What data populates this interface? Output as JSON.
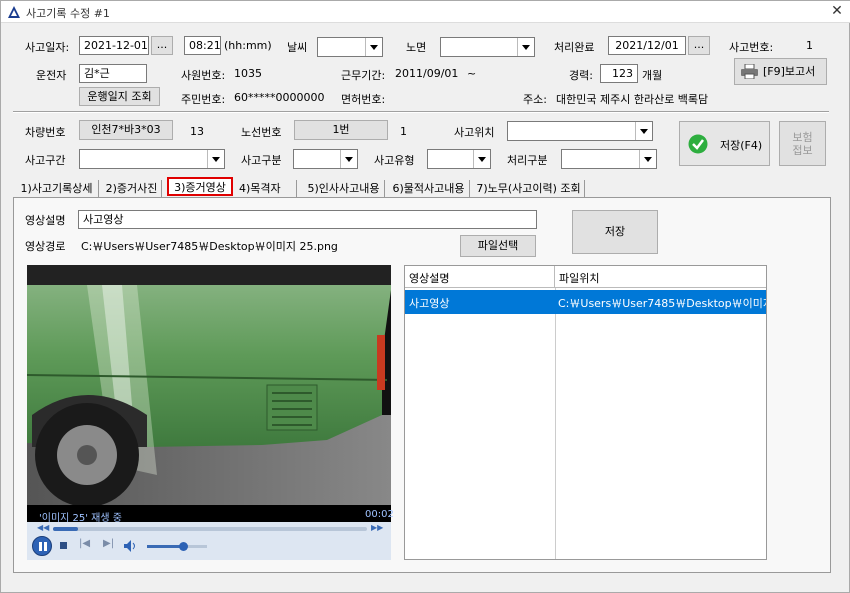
{
  "window": {
    "title": "사고기록 수정 #1",
    "close": "✕"
  },
  "row1": {
    "accident_date_label": "사고일자:",
    "accident_date": "2021-12-01",
    "date_picker": "...",
    "time": "08:21",
    "time_fmt": "(hh:mm)",
    "weather_label": "날씨",
    "road_label": "노면",
    "done_label": "처리완료",
    "done_date": "2021/12/01",
    "done_picker": "...",
    "accident_no_label": "사고번호:",
    "accident_no": "1"
  },
  "row2": {
    "driver_label": "운전자",
    "driver": "김*근",
    "emp_no_label": "사원번호:",
    "emp_no": "1035",
    "period_label": "근무기간:",
    "period": "2011/09/01",
    "period_sep": "~",
    "career_label": "경력:",
    "career": "123",
    "career_unit": "개월",
    "report_btn": "[F9]보고서"
  },
  "row3": {
    "log_btn": "운행일지 조회",
    "rrn_label": "주민번호:",
    "rrn": "60*****0000000",
    "license_label": "면허번호:",
    "address_label": "주소:",
    "address": "대한민국 제주시 한라산로 백록담"
  },
  "vehicle": {
    "car_no_label": "차량번호",
    "car_no": "인천7*바3*03",
    "car_code": "13",
    "route_label": "노선번호",
    "route": "1번",
    "route_code": "1",
    "location_label": "사고위치",
    "section_label": "사고구간",
    "type_label": "사고구분",
    "kind_label": "사고유형",
    "proc_label": "처리구분",
    "save_btn": "저장(F4)",
    "insurance_btn": "보험\n접보"
  },
  "tabs": [
    "1)사고기록상세",
    "2)증거사진",
    "3)증거영상",
    "4)목격자",
    "5)인사사고내용",
    "6)물적사고내용",
    "7)노무(사고이력) 조회"
  ],
  "video": {
    "desc_label": "영상설명",
    "desc_value": "사고영상",
    "path_label": "영상경로",
    "path_value": "C:￦Users￦User7485￦Desktop￦이미지 25.png",
    "select_btn": "파일선택",
    "save_btn": "저장",
    "status": "'이미지 25' 재생 중",
    "time": "00:02",
    "seek_progress": 0.08,
    "volume": 0.6
  },
  "grid": {
    "headers": [
      "영상설명",
      "파일위치"
    ],
    "rows": [
      {
        "desc": "사고영상",
        "path": "C:￦Users￦User7485￦Desktop￦이미지 25.png"
      }
    ]
  },
  "colors": {
    "highlight": "#0078d7",
    "active_tab_border": "#e00000",
    "save_check": "#2eae3f"
  }
}
